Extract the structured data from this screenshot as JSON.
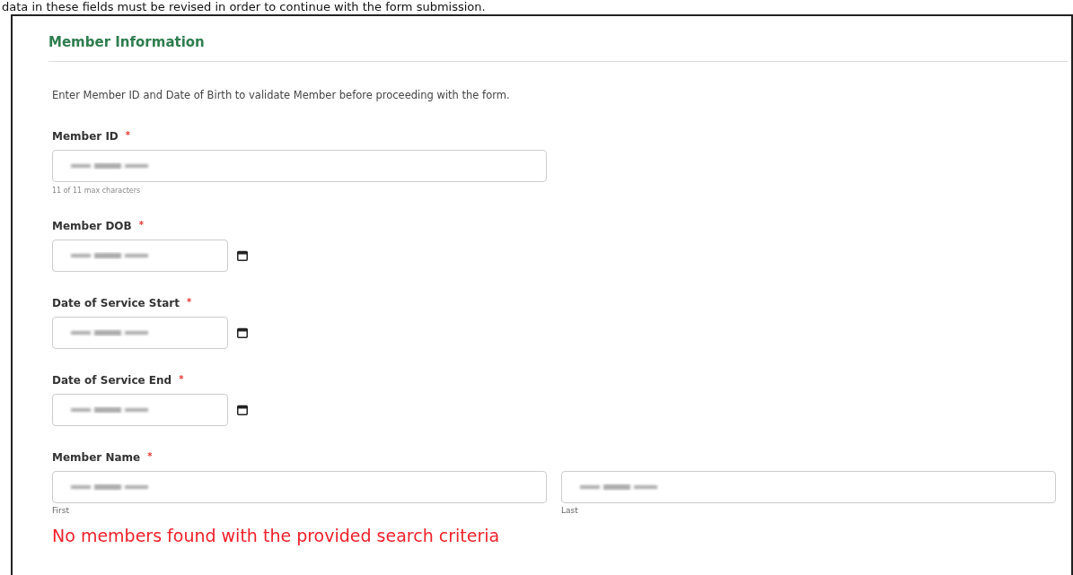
{
  "top_note": "data in these fields must be revised in order to continue with the form submission.",
  "section_title": "Member Information",
  "instruction": "Enter Member ID and Date of Birth to validate Member before proceeding with the form.",
  "fields": [
    {
      "kind": "text",
      "label": "Member ID",
      "required_mark": "*",
      "redacted": true,
      "helper": "11 of 11 max characters"
    },
    {
      "kind": "date",
      "label": "Member DOB",
      "required_mark": "*",
      "redacted": true
    },
    {
      "kind": "date",
      "label": "Date of Service Start",
      "required_mark": "*",
      "redacted": true
    },
    {
      "kind": "date",
      "label": "Date of Service End",
      "required_mark": "*",
      "redacted": true
    },
    {
      "kind": "name",
      "label": "Member Name",
      "required_mark": "*",
      "parts": [
        {
          "sublabel": "First",
          "redacted": true
        },
        {
          "sublabel": "Last",
          "redacted": true
        }
      ]
    }
  ],
  "error": "No members found with the provided search criteria"
}
